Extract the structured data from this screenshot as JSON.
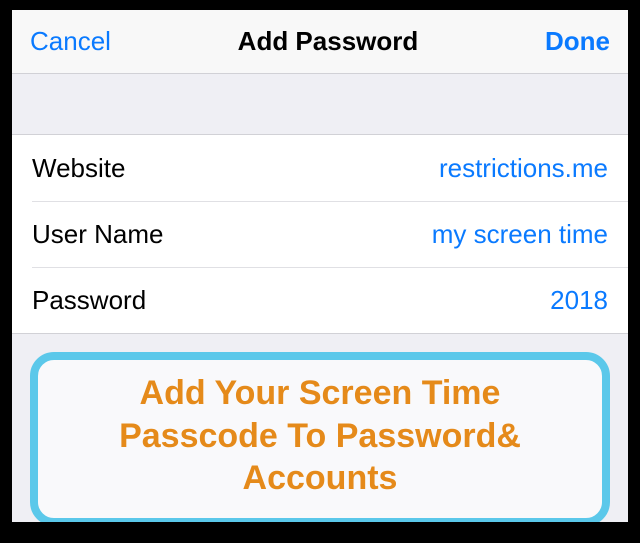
{
  "navbar": {
    "cancel": "Cancel",
    "title": "Add Password",
    "done": "Done"
  },
  "form": {
    "website": {
      "label": "Website",
      "value": "restrictions.me"
    },
    "username": {
      "label": "User Name",
      "value": "my screen time"
    },
    "password": {
      "label": "Password",
      "value": "2018"
    }
  },
  "callout": {
    "text": "Add Your Screen Time Passcode To Password& Accounts"
  },
  "colors": {
    "tint": "#0a7aff",
    "calloutBorder": "#5bc8ea",
    "calloutText": "#e58a1a"
  }
}
